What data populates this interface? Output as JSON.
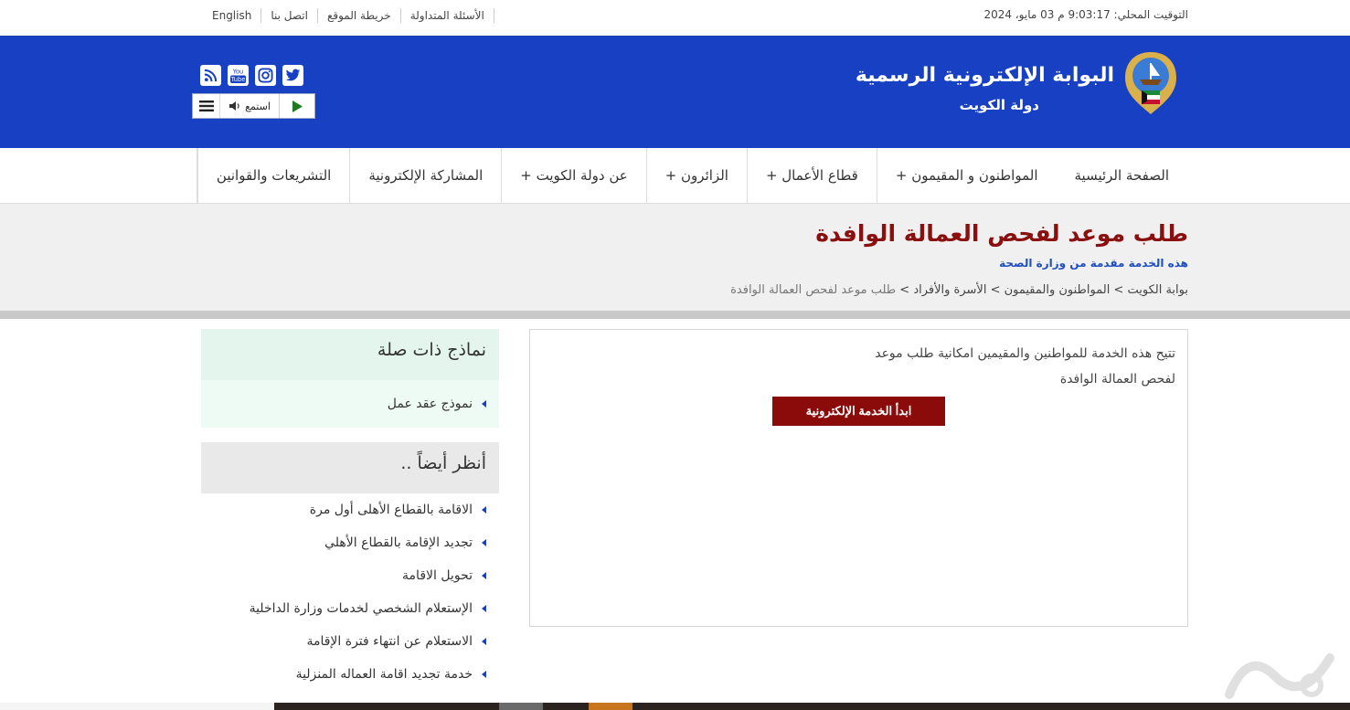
{
  "topbar": {
    "local_time": "التوقيت المحلي: 9:03:17 م 03 مايو، 2024",
    "links": [
      "English",
      "اتصل بنا",
      "خريطة الموقع",
      "الأسئلة المتداولة"
    ]
  },
  "header": {
    "title": "البوابة الإلكترونية الرسمية",
    "subtitle": "دولة  الكويت",
    "listen_label": "استمع"
  },
  "nav": {
    "items": [
      "الصفحة الرئيسية",
      "المواطنون و المقيمون +",
      "قطاع الأعمال +",
      "الزائرون +",
      "عن دولة الكويت +",
      "المشاركة الإلكترونية",
      "التشريعات والقوانين"
    ]
  },
  "page": {
    "title": "طلب موعد لفحص العمالة الوافدة",
    "provider": "هذه الخدمة مقدمة من وزارة الصحة",
    "breadcrumb": {
      "path": "بوابة الكويت > المواطنون والمقيمون > الأسرة والأفراد > ",
      "current": "طلب موعد لفحص العمالة الوافدة"
    }
  },
  "content": {
    "description": "تتيح هذه الخدمة للمواطنين والمقيمين امكانية طلب موعد لفحص العمالة الوافدة",
    "start_button": "ابدأ الخدمة الإلكترونية"
  },
  "sidebar": {
    "related_forms_title": "نماذج ذات صلة",
    "related_forms": [
      "نموذج عقد عمل"
    ],
    "see_also_title": "أنظر أيضاً ..",
    "see_also": [
      "الاقامة بالقطاع الأهلى أول مرة",
      "تجديد الإقامة بالقطاع الأهلي",
      "تحويل الاقامة",
      "الإستعلام الشخصي لخدمات وزارة الداخلية",
      "الاستعلام عن انتهاء فترة الإقامة",
      "خدمة تجديد اقامة العماله المنزلية"
    ]
  },
  "colors": {
    "header_blue": "#1740c2",
    "title_red": "#8a1010",
    "button_red": "#8b0a0a"
  }
}
